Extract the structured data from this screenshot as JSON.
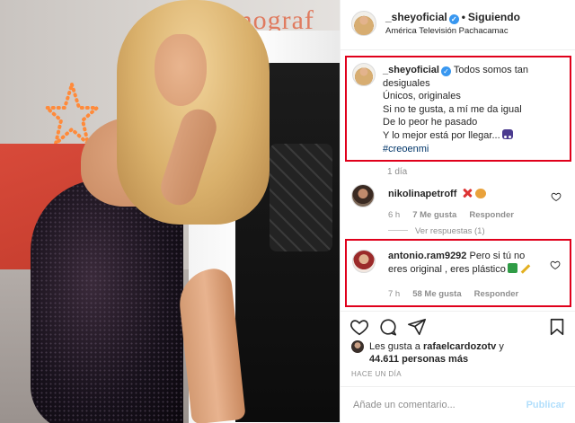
{
  "photo": {
    "sign_text": "Escenograf"
  },
  "header": {
    "username": "_sheyoficial",
    "separator": "•",
    "follow_status": "Siguiendo",
    "location": "América Televisión Pachacamac"
  },
  "caption": {
    "username": "_sheyoficial",
    "line1": "Todos somos tan desiguales",
    "line2": "Únicos, originales",
    "line3": "Si no te gusta, a mí me da igual",
    "line4": "De lo peor he pasado",
    "line5": "Y lo mejor está por llegar...",
    "hashtag": "#creoenmi",
    "time": "1 día"
  },
  "comments": [
    {
      "username": "nikolinapetroff",
      "text": "",
      "time": "6 h",
      "likes": "7 Me gusta",
      "reply_label": "Responder",
      "view_replies": "Ver respuestas (1)"
    },
    {
      "username": "antonio.ram9292",
      "text": "Pero si tú no eres original , eres plástico",
      "time": "7 h",
      "likes": "58 Me gusta",
      "reply_label": "Responder"
    }
  ],
  "actions": {
    "icons": [
      "heart-icon",
      "comment-icon",
      "share-icon",
      "bookmark-icon"
    ]
  },
  "likes": {
    "prefix": "Les gusta a",
    "user": "rafaelcardozotv",
    "connector": "y",
    "count": "44.611 personas más"
  },
  "timestamp": "HACE UN DÍA",
  "add_comment": {
    "placeholder": "Añade un comentario...",
    "post_label": "Publicar"
  },
  "colors": {
    "highlight_border": "#e0001b",
    "verified_blue": "#3897f0",
    "muted_text": "#8e8e8e"
  }
}
